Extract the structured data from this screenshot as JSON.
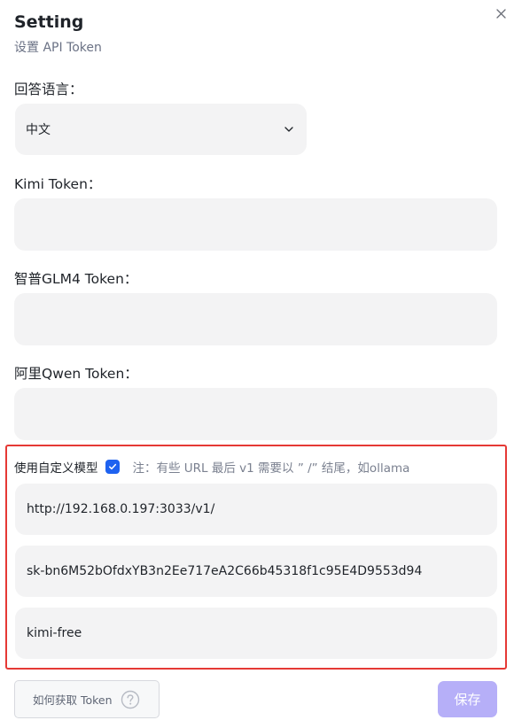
{
  "dialog": {
    "title": "Setting",
    "subtitle": "设置 API Token",
    "close_icon": "close-icon"
  },
  "language": {
    "label": "回答语言：",
    "selected": "中文",
    "chevron_icon": "chevron-down-icon"
  },
  "tokens": {
    "kimi": {
      "label": "Kimi Token：",
      "value": ""
    },
    "glm": {
      "label": "智普GLM4 Token：",
      "value": ""
    },
    "qwen": {
      "label": "阿里Qwen Token：",
      "value": ""
    }
  },
  "custom_model": {
    "label": "使用自定义模型",
    "checked": true,
    "note": "注：有些 URL 最后 v1 需要以 ” /”  结尾，如ollama",
    "highlight_color": "#e53935",
    "url_value": "http://192.168.0.197:3033/v1/",
    "key_value": "sk-bn6M52bOfdxYB3n2Ee717eA2C66b45318f1c95E4D9553d94",
    "model_value": "kimi-free"
  },
  "footer": {
    "help_label": "如何获取 Token",
    "help_icon": "question-circle-icon",
    "save_label": "保存",
    "save_color": "#b6aff8"
  },
  "colors": {
    "accent": "#1e62f0",
    "field_bg": "#f3f3f4"
  }
}
